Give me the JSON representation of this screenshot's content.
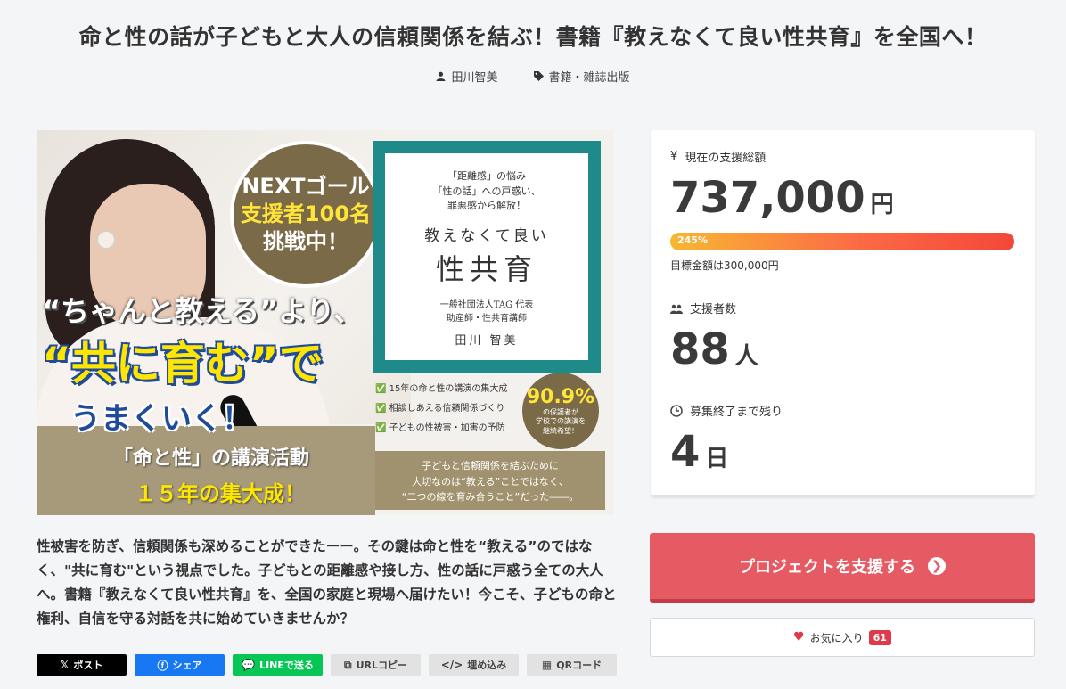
{
  "title": "命と性の話が子どもと大人の信頼関係を結ぶ！書籍『教えなくて良い性共育』を全国へ！",
  "meta": {
    "author": "田川智美",
    "category": "書籍・雑誌出版"
  },
  "hero": {
    "bubble_line1": "NEXTゴール",
    "bubble_line2": "支援者100名",
    "bubble_line3": "挑戦中！",
    "copy1": "“ちゃんと教える”より、",
    "copy2": "“共に育む”で",
    "copy3": "うまくいく！",
    "copy4": "「命と性」の講演活動",
    "copy5": "１５年の集大成！",
    "book": {
      "sub1": "「距離感」の悩み",
      "sub2": "「性の話」への戸惑い、",
      "sub3": "罪悪感から解放！",
      "title1": "教えなくて良い",
      "title2": "性共育",
      "author1": "一般社団法人TAG 代表",
      "author2": "助産師・性共育講師",
      "name": "田川 智美"
    },
    "checks": [
      "15年の命と性の講演の集大成",
      "相談しあえる信頼関係づくり",
      "子どもの性被害・加害の予防"
    ],
    "badge_num": "90.9%",
    "badge_txt1": "の保護者が",
    "badge_txt2": "学校での講演を",
    "badge_txt3": "継続希望！",
    "band1": "子どもと信頼関係を結ぶために",
    "band2": "大切なのは“教える”ことではなく、",
    "band3": "“二つの線を育み合うこと”だった――。"
  },
  "stats": {
    "total_label": "現在の支援総額",
    "total_value": "737,000",
    "total_unit": "円",
    "progress_label": "245%",
    "progress_percent": 245,
    "goal_text": "目標金額は300,000円",
    "supporters_label": "支援者数",
    "supporters_value": "88",
    "supporters_unit": "人",
    "remaining_label": "募集終了まで残り",
    "remaining_value": "4",
    "remaining_unit": "日"
  },
  "actions": {
    "support_label": "プロジェクトを支援する",
    "favorite_label": "お気に入り",
    "favorite_count": "61"
  },
  "description": "性被害を防ぎ、信頼関係も深めることができたーー。その鍵は命と性を“教える”のではなく、\"共に育む\"という視点でした。子どもとの距離感や接し方、性の話に戸惑う全ての大人へ。書籍『教えなくて良い性共育』を、全国の家庭と現場へ届けたい！今こそ、子どもの命と権利、自信を守る対話を共に始めていきませんか？",
  "share": {
    "x": "ポスト",
    "facebook": "シェア",
    "line": "LINEで送る",
    "url": "URLコピー",
    "embed": "埋め込み",
    "qr": "QRコード"
  },
  "colors": {
    "support_button": "#e65b63",
    "progress_start": "#f7b733",
    "progress_end": "#f4473a",
    "favorite_badge": "#e0394a"
  }
}
